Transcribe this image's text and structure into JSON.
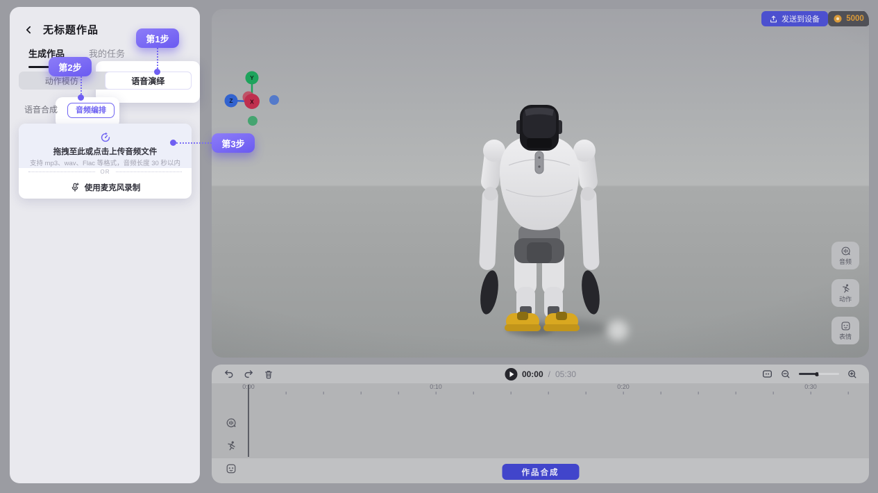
{
  "sidebar": {
    "title": "无标题作品",
    "tabs": [
      {
        "label": "生成作品",
        "active": true
      },
      {
        "label": "我的任务",
        "active": false
      }
    ],
    "modes": [
      {
        "label": "动作模仿",
        "active": false
      },
      {
        "label": "语音演绎",
        "active": true
      }
    ],
    "sub_tabs": [
      {
        "label": "语音合成",
        "active": false
      },
      {
        "label": "音频编排",
        "active": true
      }
    ],
    "upload": {
      "title": "拖拽至此或点击上传音频文件",
      "hint": "支持 mp3、wav、Flac 等格式，音频长度 30 秒以内",
      "divider": "OR",
      "mic_label": "使用麦克风录制"
    }
  },
  "tutorial": {
    "steps": [
      {
        "label": "第1步"
      },
      {
        "label": "第2步"
      },
      {
        "label": "第3步"
      }
    ]
  },
  "viewport": {
    "send_label": "发送到设备",
    "credits": "5000",
    "axis": {
      "x": "X",
      "y": "Y",
      "z": "Z"
    },
    "tools": [
      {
        "label": "音频"
      },
      {
        "label": "动作"
      },
      {
        "label": "表情"
      }
    ]
  },
  "timeline": {
    "current": "00:00",
    "separator": "/",
    "total": "05:30",
    "ruler": [
      "0:00",
      "0:10",
      "0:20",
      "0:30"
    ],
    "compose_label": "作品合成"
  },
  "colors": {
    "accent": "#6f63f2",
    "primary_button": "#4145cb",
    "coin": "#d99a3a"
  }
}
